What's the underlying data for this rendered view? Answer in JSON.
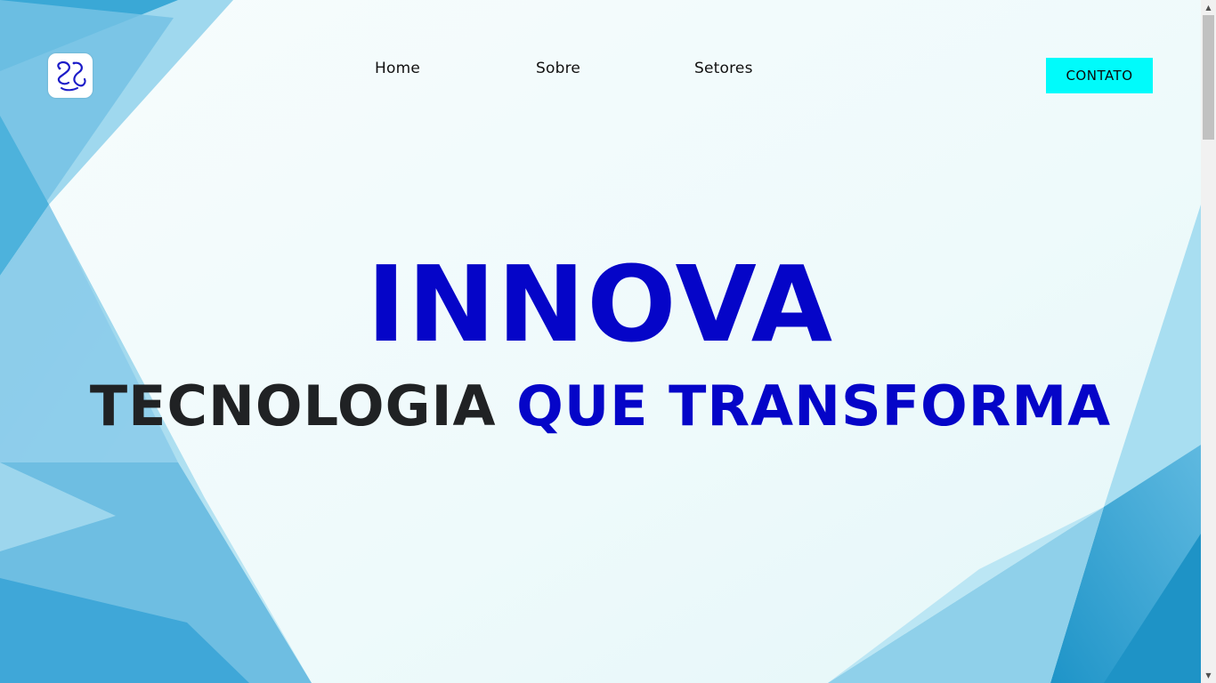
{
  "header": {
    "logo_icon": "snake-logo-icon",
    "nav": [
      {
        "label": "Home"
      },
      {
        "label": "Sobre"
      },
      {
        "label": "Setores"
      }
    ],
    "contact_button": "CONTATO"
  },
  "hero": {
    "title": "INNOVA",
    "subtitle_dark": "TECNOLOGIA",
    "subtitle_blue": "QUE TRANSFORMA"
  },
  "colors": {
    "brand_blue": "#0505c8",
    "accent_cyan": "#00fbfb",
    "text_dark": "#202224"
  },
  "scrollbar": {
    "up_icon": "arrow-up-icon",
    "down_icon": "arrow-down-icon"
  }
}
